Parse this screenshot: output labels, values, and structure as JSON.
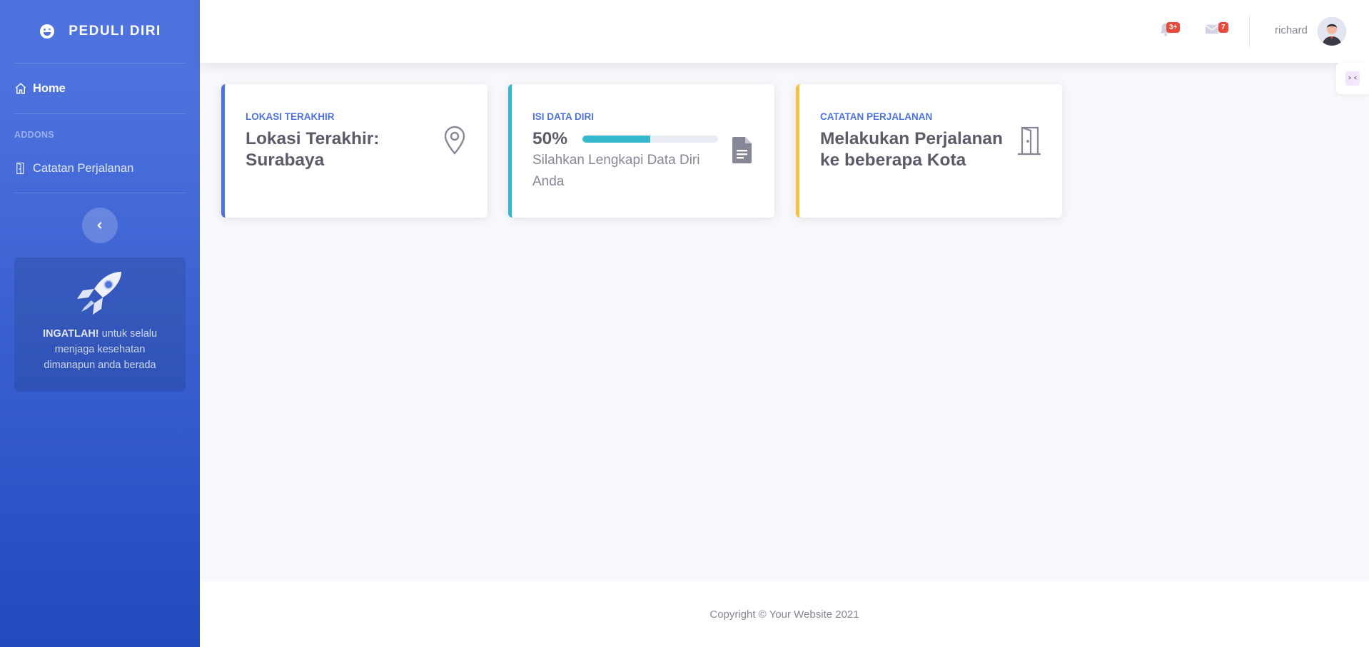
{
  "brand": {
    "name": "PEDULI DIRI",
    "icon": "laugh-wink-icon"
  },
  "sidebar": {
    "nav_home": "Home",
    "heading": "Addons",
    "nav_catatan": "Catatan Perjalanan",
    "card": {
      "strong": "INGATLAH!",
      "text": " untuk selalu menjaga kesehatan dimanapun anda berada"
    }
  },
  "topbar": {
    "alerts_badge": "3+",
    "messages_badge": "7",
    "user_name": "richard"
  },
  "cards": {
    "lokasi": {
      "label": "LOKASI TERAKHIR",
      "value": "Lokasi Terakhir: Surabaya"
    },
    "data_diri": {
      "label": "ISI DATA DIRI",
      "percent": "50%",
      "progress": 0.5,
      "desc": "Silahkan Lengkapi Data Diri Anda"
    },
    "catatan": {
      "label": "CATATAN PERJALANAN",
      "value": "Melakukan Perjalanan ke beberapa Kota"
    }
  },
  "footer": {
    "copyright": "Copyright © Your Website 2021"
  },
  "colors": {
    "primary": "#4e73df",
    "info": "#36b9cc",
    "warning": "#f6c23e",
    "danger": "#e74a3b"
  }
}
